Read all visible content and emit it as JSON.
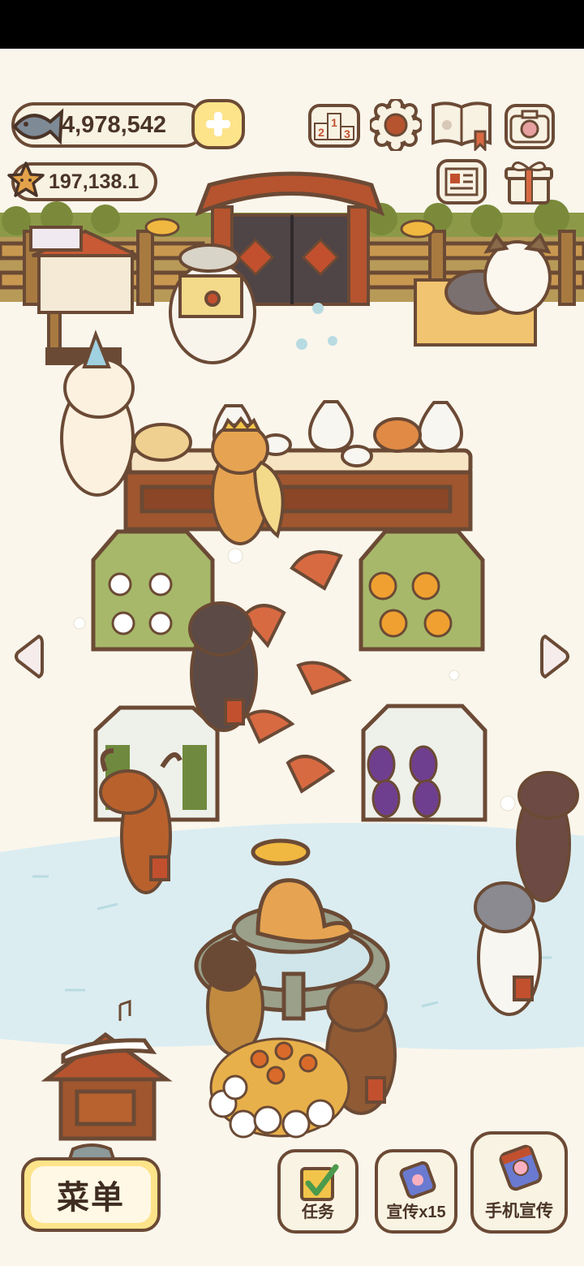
{
  "currency": {
    "fish_amount": "4,978,542",
    "star_amount": "197,138.1"
  },
  "icons": {
    "fish": "fish-icon",
    "plus": "plus-icon",
    "star": "star-icon",
    "ranking": "ranking-podium-icon",
    "settings": "gear-icon",
    "book": "cat-book-icon",
    "camera": "camera-icon",
    "news": "newspaper-icon",
    "gift": "gift-box-icon",
    "left": "left-arrow-icon",
    "right": "right-arrow-icon"
  },
  "ranking_digits": [
    "2",
    "1",
    "3"
  ],
  "bottom": {
    "menu_label": "菜单",
    "tasks_label": "任务",
    "promote_label": "宣传x15",
    "phone_promote_label": "手机宣传"
  },
  "colors": {
    "outline": "#6b4a35",
    "cream": "#faf5e8",
    "menu_yellow": "#fde48a",
    "roof_red": "#b5542f",
    "water": "#d8ecef",
    "snow": "#ffffff"
  }
}
